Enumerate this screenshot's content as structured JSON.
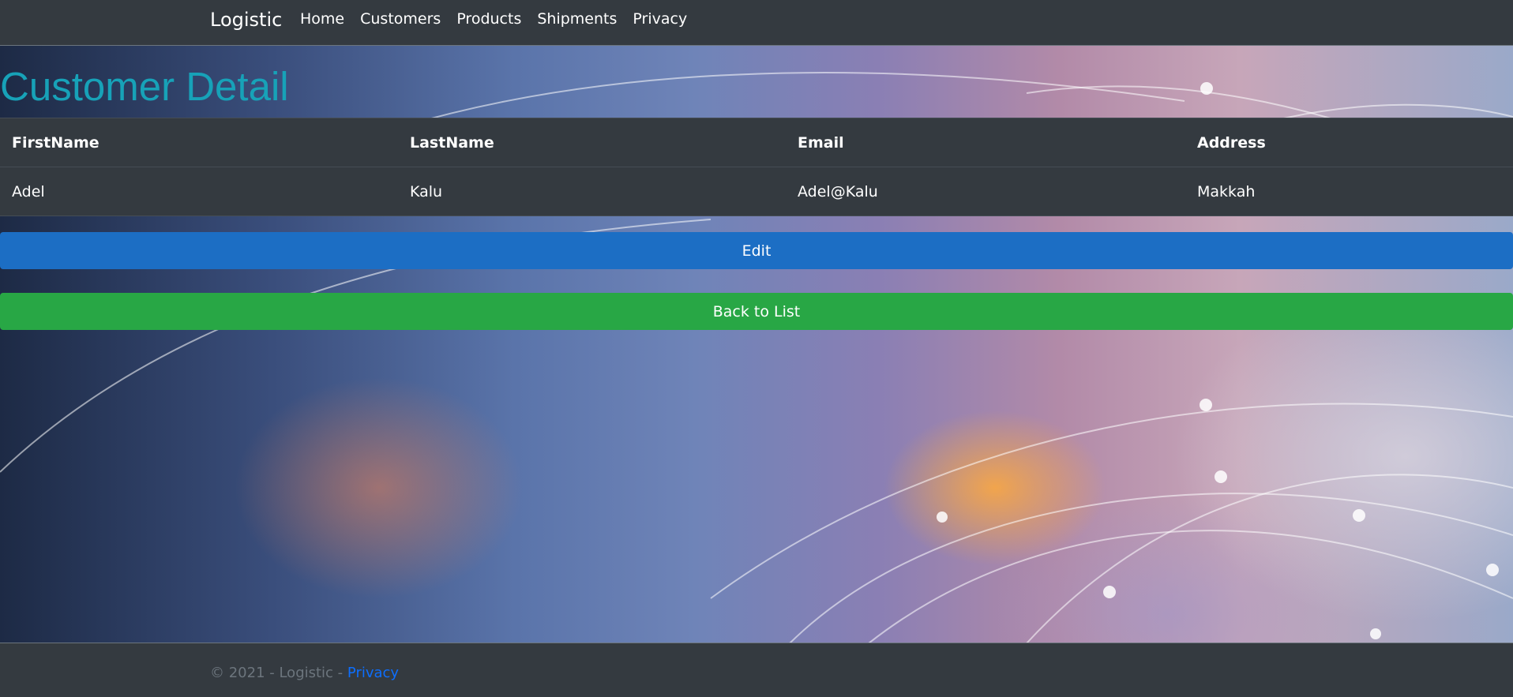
{
  "nav": {
    "brand": "Logistic",
    "links": [
      "Home",
      "Customers",
      "Products",
      "Shipments",
      "Privacy"
    ]
  },
  "page": {
    "title": "Customer Detail"
  },
  "table": {
    "headers": [
      "FirstName",
      "LastName",
      "Email",
      "Address"
    ],
    "rows": [
      [
        "Adel",
        "Kalu",
        "Adel@Kalu",
        "Makkah"
      ]
    ]
  },
  "buttons": {
    "edit_label": "Edit",
    "back_label": "Back to List"
  },
  "footer": {
    "text": "© 2021 - Logistic - ",
    "privacy_label": "Privacy"
  },
  "colors": {
    "navbar_bg": "#343a40",
    "title": "#17a2b8",
    "edit_button": "#1c6ec4",
    "back_button": "#28a745",
    "footer_link": "#0d6efd"
  }
}
